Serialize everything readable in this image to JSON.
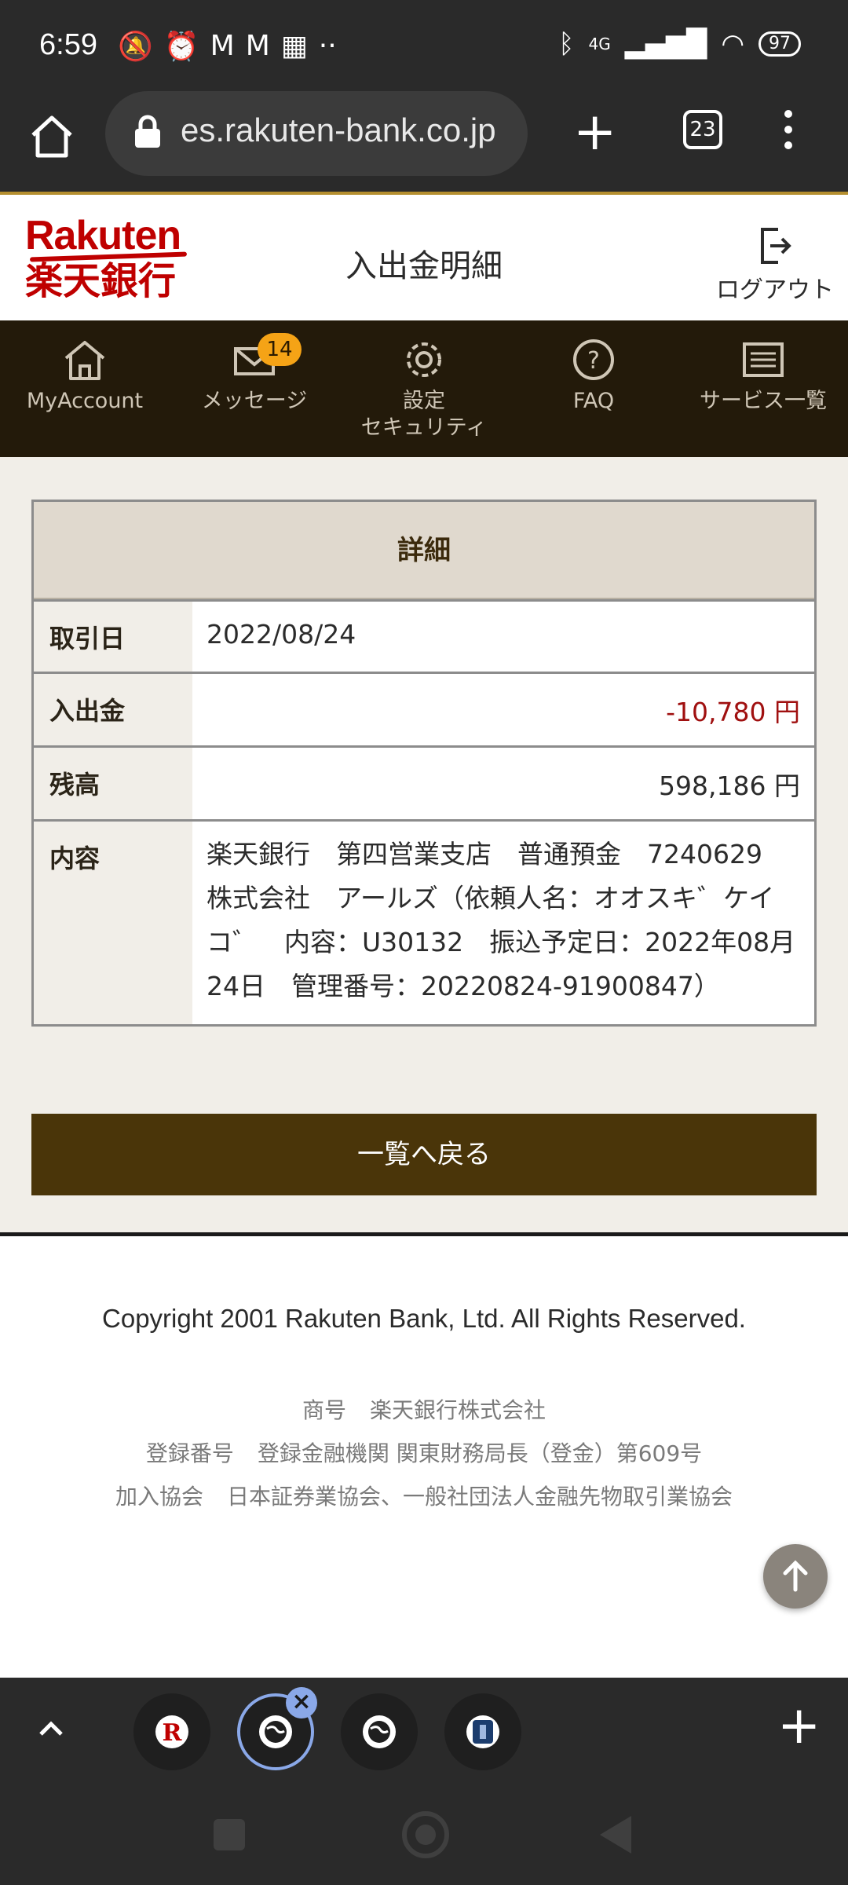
{
  "status_bar": {
    "time": "6:59",
    "battery": "97",
    "network": "4G"
  },
  "browser": {
    "url": "es.rakuten-bank.co.jp",
    "tab_count": "23"
  },
  "header": {
    "logo_en": "Rakuten",
    "logo_jp": "楽天銀行",
    "title": "入出金明細",
    "logout_label": "ログアウト"
  },
  "nav": {
    "items": [
      {
        "label": "MyAccount",
        "icon": "home-icon"
      },
      {
        "label": "メッセージ",
        "icon": "mail-icon",
        "badge": "14"
      },
      {
        "label": "設定\nセキュリティ",
        "line1": "設定",
        "line2": "セキュリティ",
        "icon": "gear-icon"
      },
      {
        "label": "FAQ",
        "icon": "help-icon"
      },
      {
        "label": "サービス一覧",
        "icon": "list-icon"
      }
    ]
  },
  "detail": {
    "heading": "詳細",
    "rows": [
      {
        "key": "取引日",
        "value": "2022/08/24"
      },
      {
        "key": "入出金",
        "value": "-10,780 円"
      },
      {
        "key": "残高",
        "value": "598,186 円"
      },
      {
        "key": "内容",
        "value": "楽天銀行　第四営業支店　普通預金　7240629　株式会社　アールズ（依頼人名：オオスキ゛ケイコ゛　内容：U30132　振込予定日：2022年08月24日　管理番号：20220824-91900847）"
      }
    ],
    "back_button": "一覧へ戻る"
  },
  "footer": {
    "copyright": "Copyright 2001 Rakuten Bank, Ltd. All Rights Reserved.",
    "info": [
      {
        "label": "商号",
        "value": "楽天銀行株式会社"
      },
      {
        "label": "登録番号",
        "value": "登録金融機関 関東財務局長（登金）第609号"
      },
      {
        "label": "加入協会",
        "value": "日本証券業協会、一般社団法人金融先物取引業協会"
      }
    ]
  },
  "colors": {
    "brand": "#bf0000",
    "nav_bg": "#231a0a",
    "button_bg": "#4a3509",
    "negative": "#a01010",
    "badge": "#f5a316"
  }
}
